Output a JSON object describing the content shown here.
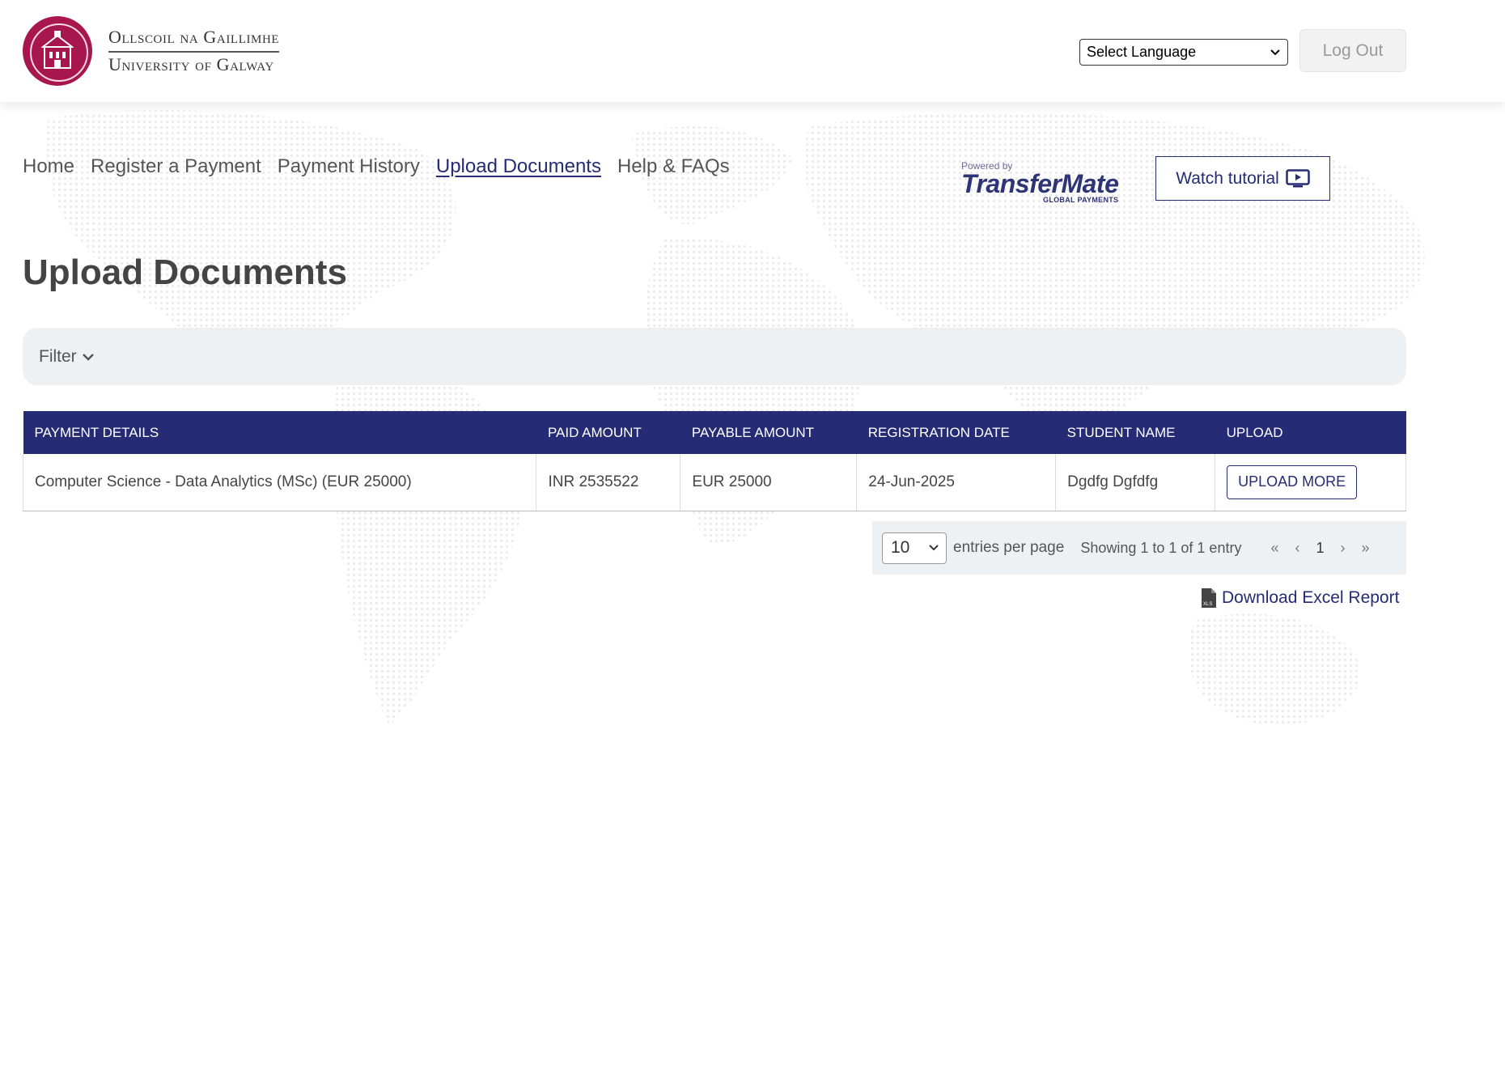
{
  "header": {
    "logo_line1": "Ollscoil na Gaillimhe",
    "logo_line2": "University of Galway",
    "language_select": "Select Language",
    "logout_label": "Log Out"
  },
  "nav": {
    "items": [
      "Home",
      "Register a Payment",
      "Payment History",
      "Upload Documents",
      "Help & FAQs"
    ],
    "active": "Upload Documents"
  },
  "transfermate": {
    "powered_by": "Powered by",
    "name": "TransferMate",
    "sub": "GLOBAL PAYMENTS"
  },
  "watch_tutorial_label": "Watch tutorial",
  "page_title": "Upload Documents",
  "filter_label": "Filter",
  "table": {
    "columns": [
      "PAYMENT DETAILS",
      "PAID AMOUNT",
      "PAYABLE AMOUNT",
      "REGISTRATION DATE",
      "STUDENT NAME",
      "UPLOAD"
    ],
    "rows": [
      {
        "payment_details": "Computer Science - Data Analytics (MSc) (EUR 25000)",
        "paid_amount": "INR 2535522",
        "payable_amount": "EUR 25000",
        "registration_date": "24-Jun-2025",
        "student_name": "Dgdfg Dgfdfg",
        "upload_label": "UPLOAD MORE"
      }
    ]
  },
  "pagination": {
    "per_page": "10",
    "per_page_label": "entries per page",
    "showing": "Showing 1 to 1 of 1 entry",
    "first": "«",
    "prev": "‹",
    "current": "1",
    "next": "›",
    "last": "»"
  },
  "download_label": "Download Excel Report",
  "colors": {
    "brand_navy": "#252c75",
    "galway_maroon": "#a7164d",
    "filter_bg": "#eef1f4"
  }
}
